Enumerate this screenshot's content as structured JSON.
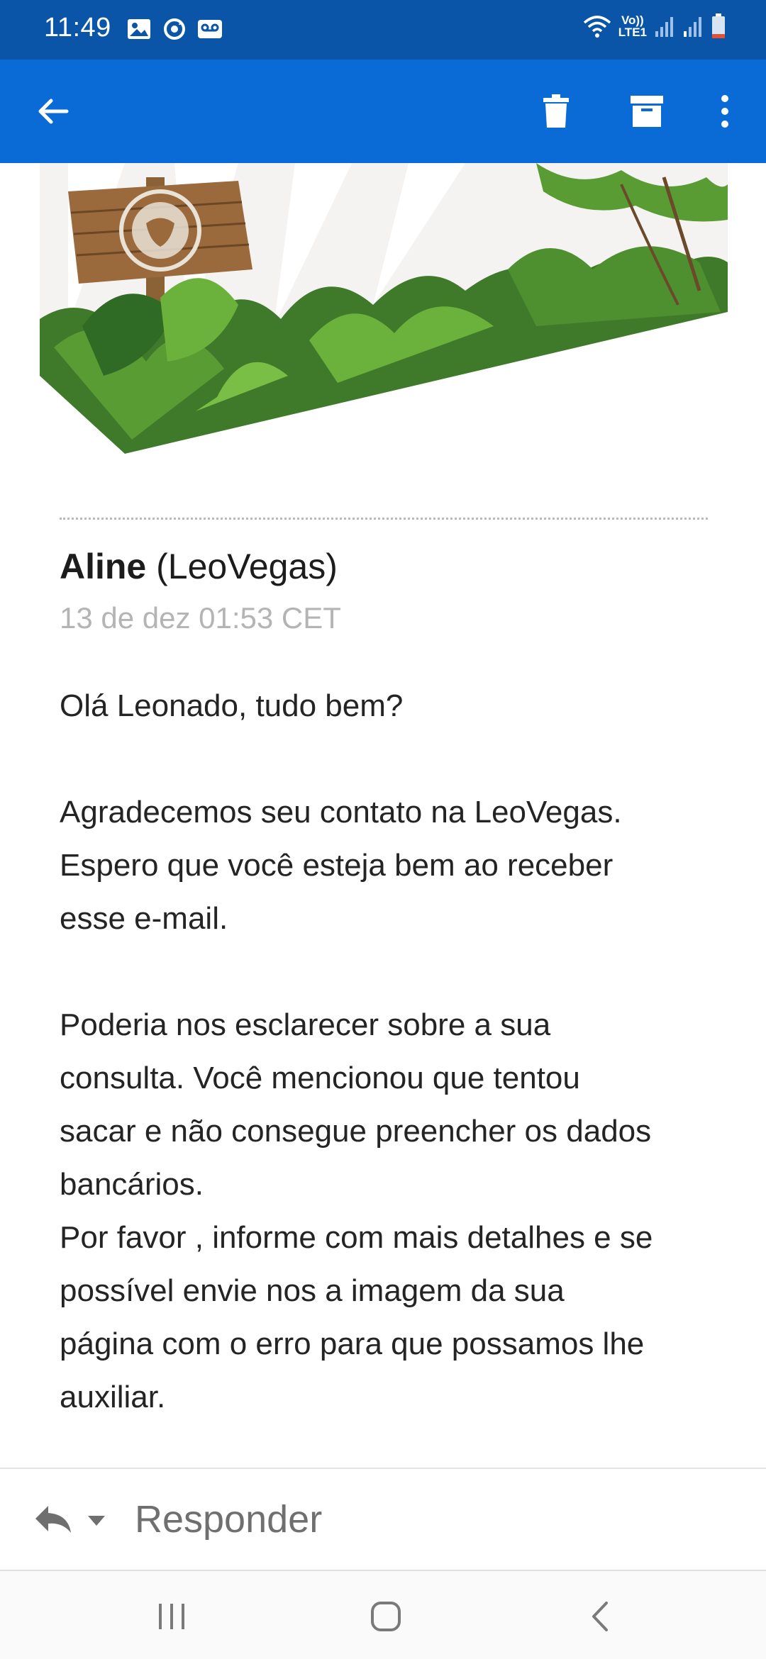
{
  "status_bar": {
    "time": "11:49",
    "volte_top": "Vo))",
    "volte_bottom": "LTE1",
    "left_icons": [
      "gallery-icon",
      "sync-icon",
      "voicemail-icon"
    ],
    "right_icons": [
      "wifi-icon",
      "signal-icon",
      "signal-icon",
      "battery-low-icon"
    ],
    "battery_level": 0.15
  },
  "app_bar": {
    "icons": [
      "back-arrow-icon",
      "delete-icon",
      "archive-icon",
      "more-vert-icon"
    ],
    "color": "#0a6ad6"
  },
  "banner": {
    "description_icon": "leovegas-banner-image"
  },
  "email": {
    "sender_name": "Aline",
    "sender_org": "(LeoVegas)",
    "date": "13 de dez 01:53 CET",
    "greeting": "Olá Leonado, tudo bem?",
    "paragraph_1": [
      "Agradecemos seu contato na LeoVegas.",
      "Espero que você esteja bem ao receber",
      "esse e-mail."
    ],
    "paragraph_2": [
      "Poderia nos esclarecer sobre a sua",
      "consulta. Você mencionou que tentou",
      "sacar e não consegue preencher os dados",
      "bancários.",
      "Por favor , informe com mais detalhes e se",
      "possível envie nos a imagem da sua",
      "página com o erro para que possamos lhe",
      "auxiliar."
    ]
  },
  "reply_bar": {
    "label": "Responder"
  },
  "colors": {
    "status_bar": "#0a55a8",
    "app_bar": "#0a6ad6",
    "date_text": "#b4b4b4"
  }
}
